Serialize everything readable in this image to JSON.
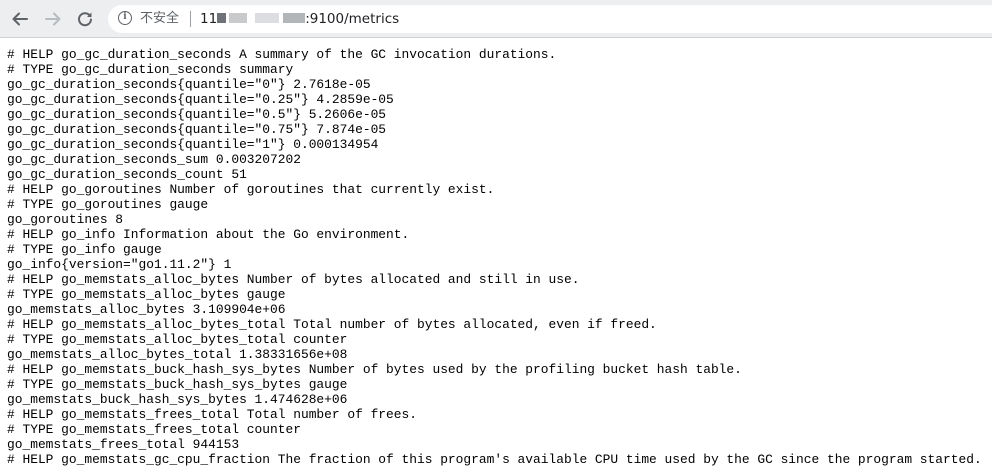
{
  "browser": {
    "back_icon": "arrow-left-icon",
    "forward_icon": "arrow-right-icon",
    "reload_icon": "reload-icon",
    "security_icon": "info-icon",
    "security_label": "不安全",
    "url_prefix": "11",
    "url_suffix": ":9100/metrics"
  },
  "metrics_lines": [
    "# HELP go_gc_duration_seconds A summary of the GC invocation durations.",
    "# TYPE go_gc_duration_seconds summary",
    "go_gc_duration_seconds{quantile=\"0\"} 2.7618e-05",
    "go_gc_duration_seconds{quantile=\"0.25\"} 4.2859e-05",
    "go_gc_duration_seconds{quantile=\"0.5\"} 5.2606e-05",
    "go_gc_duration_seconds{quantile=\"0.75\"} 7.874e-05",
    "go_gc_duration_seconds{quantile=\"1\"} 0.000134954",
    "go_gc_duration_seconds_sum 0.003207202",
    "go_gc_duration_seconds_count 51",
    "# HELP go_goroutines Number of goroutines that currently exist.",
    "# TYPE go_goroutines gauge",
    "go_goroutines 8",
    "# HELP go_info Information about the Go environment.",
    "# TYPE go_info gauge",
    "go_info{version=\"go1.11.2\"} 1",
    "# HELP go_memstats_alloc_bytes Number of bytes allocated and still in use.",
    "# TYPE go_memstats_alloc_bytes gauge",
    "go_memstats_alloc_bytes 3.109904e+06",
    "# HELP go_memstats_alloc_bytes_total Total number of bytes allocated, even if freed.",
    "# TYPE go_memstats_alloc_bytes_total counter",
    "go_memstats_alloc_bytes_total 1.38331656e+08",
    "# HELP go_memstats_buck_hash_sys_bytes Number of bytes used by the profiling bucket hash table.",
    "# TYPE go_memstats_buck_hash_sys_bytes gauge",
    "go_memstats_buck_hash_sys_bytes 1.474628e+06",
    "# HELP go_memstats_frees_total Total number of frees.",
    "# TYPE go_memstats_frees_total counter",
    "go_memstats_frees_total 944153",
    "# HELP go_memstats_gc_cpu_fraction The fraction of this program's available CPU time used by the GC since the program started."
  ]
}
